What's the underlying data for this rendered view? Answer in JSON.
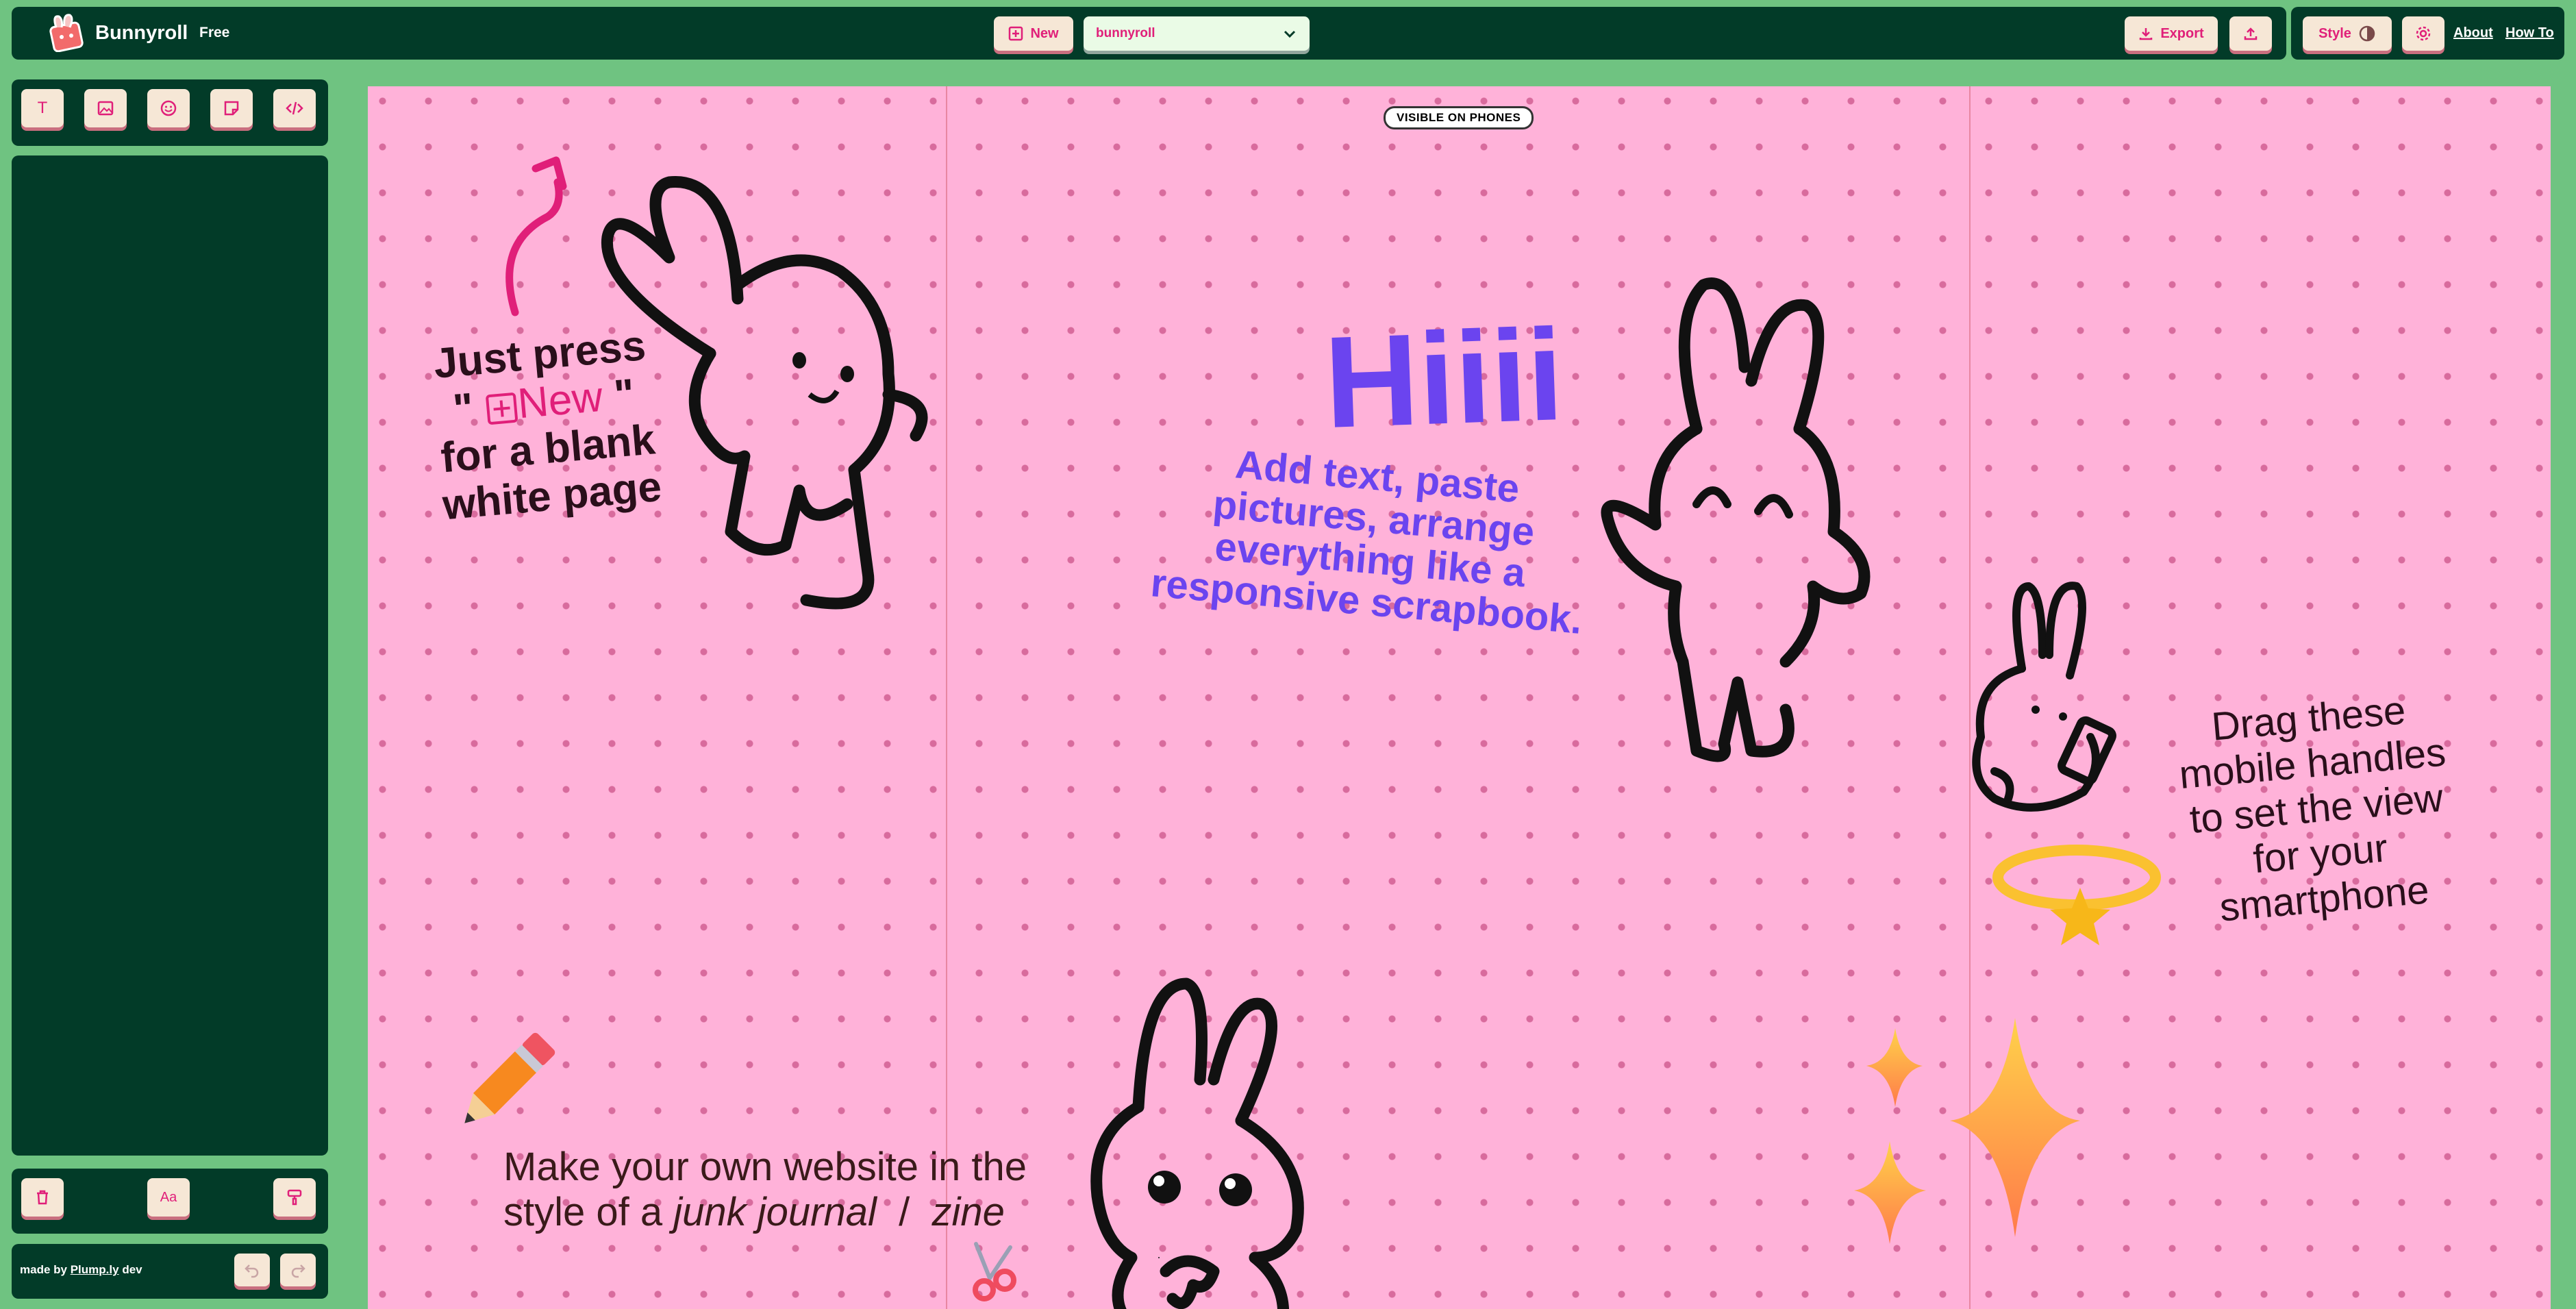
{
  "app": {
    "name": "Bunnyroll",
    "plan": "Free"
  },
  "toolbar": {
    "new_label": "New",
    "project_selected": "bunnyroll",
    "export_label": "Export",
    "style_label": "Style",
    "about_label": "About",
    "howto_label": "How To"
  },
  "tools": [
    {
      "name": "text-tool",
      "icon": "T"
    },
    {
      "name": "image-tool",
      "icon": "image-icon"
    },
    {
      "name": "emoji-tool",
      "icon": "smiley-icon"
    },
    {
      "name": "sticker-tool",
      "icon": "sticker-icon"
    },
    {
      "name": "embed-tool",
      "icon": "</>"
    }
  ],
  "bottom_tools": {
    "font_label": "Aa"
  },
  "footer": {
    "made_by_prefix": "made by",
    "made_by_link": "Plump.ly",
    "made_by_suffix": "dev"
  },
  "canvas": {
    "badge": "VISIBLE ON PHONES",
    "just_press_line1": "Just press",
    "just_press_quote_open": "\"",
    "just_press_new": "New",
    "just_press_quote_close": "\"",
    "just_press_line3": "for a blank",
    "just_press_line4": "white page",
    "hiii": "Hiiii",
    "add_text_line1": "Add text, paste",
    "add_text_line2": "pictures, arrange",
    "add_text_line3": "everything like a",
    "add_text_line4": "responsive scrapbook.",
    "drag_line1": "Drag these",
    "drag_line2": "mobile handles",
    "drag_line3": "to set the view",
    "drag_line4": "for your",
    "drag_line5": "smartphone",
    "make_line1": "Make your own website in the",
    "make_line2_prefix": "style of a",
    "make_line2_italic1": "junk journal",
    "make_line2_sep": "/",
    "make_line2_italic2": "zine"
  },
  "colors": {
    "dark_green": "#023b28",
    "light_green": "#6fc381",
    "canvas_pink": "#ffb2d9",
    "accent_magenta": "#e01f79",
    "purple": "#6b44ef"
  }
}
